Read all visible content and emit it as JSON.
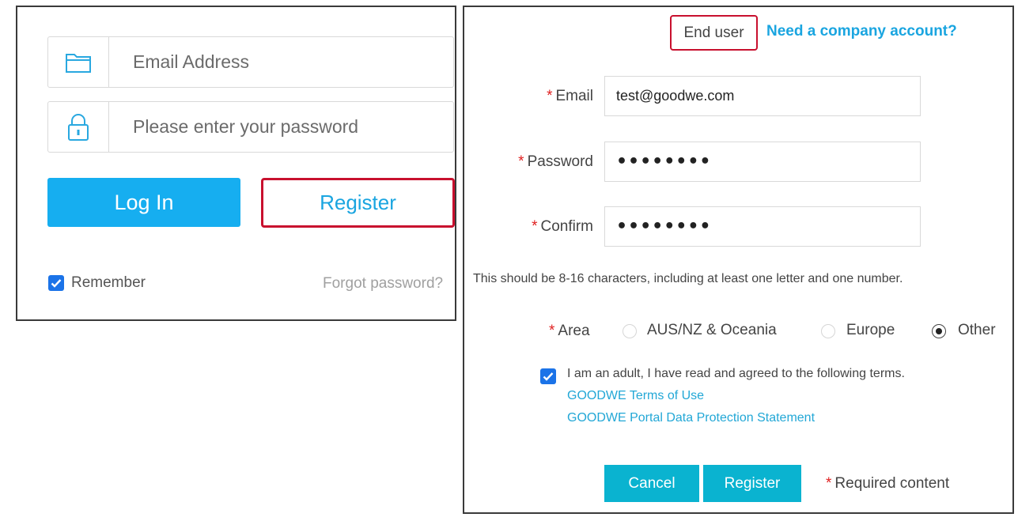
{
  "login": {
    "email_placeholder": "Email Address",
    "password_placeholder": "Please enter your password",
    "login_button": "Log In",
    "register_button": "Register",
    "remember_label": "Remember",
    "remember_checked": true,
    "forgot_link": "Forgot password?",
    "icons": {
      "email": "folder-icon",
      "password": "lock-icon"
    }
  },
  "register": {
    "tab_end_user": "End user",
    "company_link": "Need a company account?",
    "required_mark": "*",
    "email_label": "Email",
    "email_value": "test@goodwe.com",
    "password_label": "Password",
    "password_value": "••••••••",
    "confirm_label": "Confirm",
    "confirm_value": "••••••••",
    "hint": "This should be 8-16 characters, including at least one letter and one number.",
    "area_label": "Area",
    "area_options": [
      "AUS/NZ & Oceania",
      "Europe",
      "Other"
    ],
    "area_selected": "Other",
    "terms_text": "I am an adult, I have read and agreed to the following terms.",
    "terms_checked": true,
    "terms_link_1": "GOODWE Terms of Use",
    "terms_link_2": "GOODWE Portal Data Protection Statement",
    "cancel_button": "Cancel",
    "register_button": "Register",
    "required_note": "Required content"
  },
  "colors": {
    "primary_blue": "#16aef0",
    "teal_button": "#0ab3d0",
    "highlight_red": "#c8102e",
    "required_red": "#e02020",
    "link_blue": "#1aa5e0",
    "checkbox_blue": "#1b73e8"
  }
}
